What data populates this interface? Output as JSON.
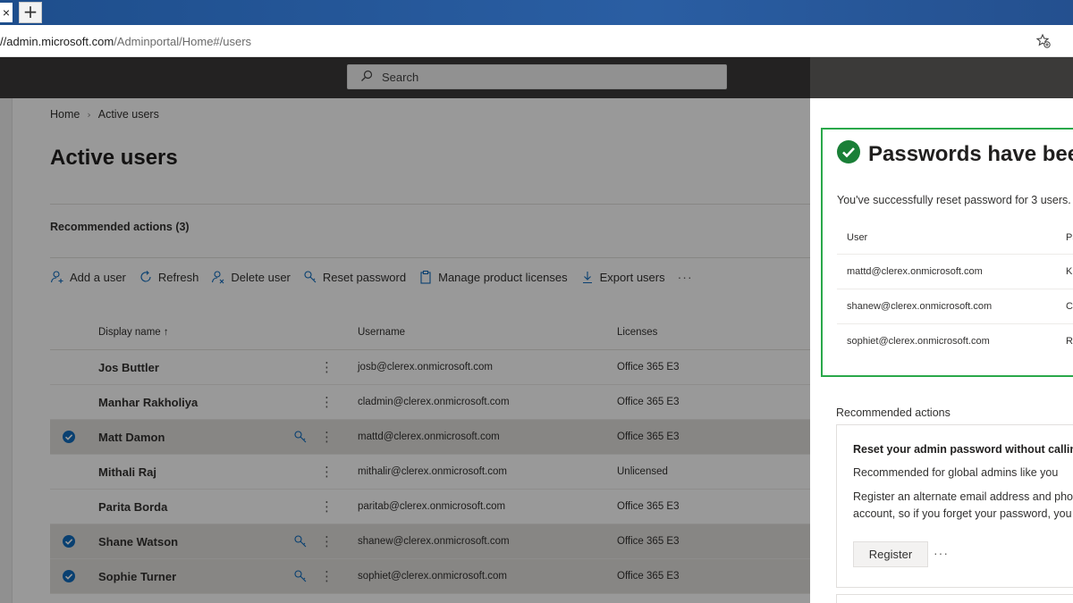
{
  "browser": {
    "tab_close": "×",
    "new_tab": "+",
    "url_host": "//admin.microsoft.com",
    "url_path": "/Adminportal/Home#/users",
    "favorite_icon": "star-add-icon"
  },
  "header": {
    "search_placeholder": "Search"
  },
  "breadcrumb": {
    "home": "Home",
    "separator": "›",
    "current": "Active users"
  },
  "page": {
    "title": "Active users",
    "recommended_actions": "Recommended actions (3)"
  },
  "toolbar": {
    "add_user": "Add a user",
    "refresh": "Refresh",
    "delete_user": "Delete user",
    "reset_password": "Reset password",
    "manage_licenses": "Manage product licenses",
    "export_users": "Export users",
    "more": "···"
  },
  "table": {
    "columns": {
      "display_name": "Display name ↑",
      "username": "Username",
      "licenses": "Licenses"
    },
    "kebab": "⋮",
    "rows": [
      {
        "name": "Jos Buttler",
        "username": "josb@clerex.onmicrosoft.com",
        "license": "Office 365 E3",
        "selected": false
      },
      {
        "name": "Manhar Rakholiya",
        "username": "cladmin@clerex.onmicrosoft.com",
        "license": "Office 365 E3",
        "selected": false
      },
      {
        "name": "Matt Damon",
        "username": "mattd@clerex.onmicrosoft.com",
        "license": "Office 365 E3",
        "selected": true
      },
      {
        "name": "Mithali Raj",
        "username": "mithalir@clerex.onmicrosoft.com",
        "license": "Unlicensed",
        "selected": false
      },
      {
        "name": "Parita Borda",
        "username": "paritab@clerex.onmicrosoft.com",
        "license": "Office 365 E3",
        "selected": false
      },
      {
        "name": "Shane Watson",
        "username": "shanew@clerex.onmicrosoft.com",
        "license": "Office 365 E3",
        "selected": true
      },
      {
        "name": "Sophie Turner",
        "username": "sophiet@clerex.onmicrosoft.com",
        "license": "Office 365 E3",
        "selected": true
      }
    ]
  },
  "panel": {
    "title": "Passwords have bee",
    "message": "You've successfully reset password for 3 users.",
    "col_user": "User",
    "col_password": "Pa",
    "results": [
      {
        "user": "mattd@clerex.onmicrosoft.com",
        "password": "Ku"
      },
      {
        "user": "shanew@clerex.onmicrosoft.com",
        "password": "Ca"
      },
      {
        "user": "sophiet@clerex.onmicrosoft.com",
        "password": "Ra"
      }
    ],
    "recommended_title": "Recommended actions",
    "card_title": "Reset your admin password without calling",
    "card_subtitle": "Recommended for global admins like you",
    "card_desc_1": "Register an alternate email address and pho",
    "card_desc_2": "account, so if you forget your password, you",
    "register_label": "Register",
    "card_more": "···"
  },
  "colors": {
    "header_bg": "#3b3a39",
    "accent_blue": "#0f6cbd",
    "success_green": "#1a7f37",
    "highlight_border": "#2aa84a"
  }
}
